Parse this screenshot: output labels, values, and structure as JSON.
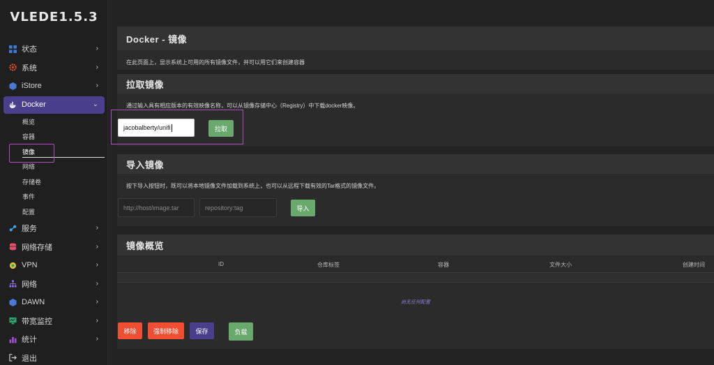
{
  "app": {
    "logo": "VLEDE1.5.3"
  },
  "sidebar": {
    "items": [
      {
        "label": "状态",
        "icon": "dashboard-icon",
        "color": "#3f7bd4"
      },
      {
        "label": "系统",
        "icon": "gear-icon",
        "color": "#e8502c"
      },
      {
        "label": "iStore",
        "icon": "cube-icon",
        "color": "#4b79d6"
      },
      {
        "label": "Docker",
        "icon": "docker-whale-icon",
        "color": "#ffffff",
        "active": true
      },
      {
        "label": "服务",
        "icon": "share-nodes-icon",
        "color": "#3da6e0"
      },
      {
        "label": "网络存储",
        "icon": "database-icon",
        "color": "#e0506b"
      },
      {
        "label": "VPN",
        "icon": "vpn-icon",
        "color": "#e0c23a"
      },
      {
        "label": "网络",
        "icon": "sitemap-icon",
        "color": "#8b6fe0"
      },
      {
        "label": "DAWN",
        "icon": "cube-icon",
        "color": "#4b79d6"
      },
      {
        "label": "带宽监控",
        "icon": "monitor-icon",
        "color": "#2ea774"
      },
      {
        "label": "统计",
        "icon": "chart-icon",
        "color": "#9a4fd0"
      },
      {
        "label": "退出",
        "icon": "logout-icon",
        "color": "#d0d0d0"
      }
    ],
    "docker_sub": [
      "概览",
      "容器",
      "镜像",
      "网络",
      "存储卷",
      "事件",
      "配置"
    ]
  },
  "page": {
    "title": "Docker - 镜像",
    "description": "在此页面上，显示系统上可用的所有镜像文件，并可以用它们来创建容器"
  },
  "pull": {
    "title": "拉取镜像",
    "description": "通过输入具有相应版本的有效映像名称，可以从镜像存储中心（Registry）中下载docker映像。",
    "input_value": "jacobalberty/unifi",
    "button": "拉取"
  },
  "import": {
    "title": "导入镜像",
    "description": "按下导入按钮时，既可以将本地镜像文件加载到系统上，也可以从远程下载有效的Tar格式的镜像文件。",
    "url_placeholder": "http://host/image.tar",
    "repo_placeholder": "repository:tag",
    "button": "导入"
  },
  "overview": {
    "title": "镜像概览",
    "columns": [
      "ID",
      "仓库标签",
      "容器",
      "文件大小",
      "创建时间"
    ],
    "empty": "尚无任何配置",
    "buttons": {
      "remove": "移除",
      "force_remove": "强制移除",
      "save": "保存",
      "load": "负载"
    }
  }
}
